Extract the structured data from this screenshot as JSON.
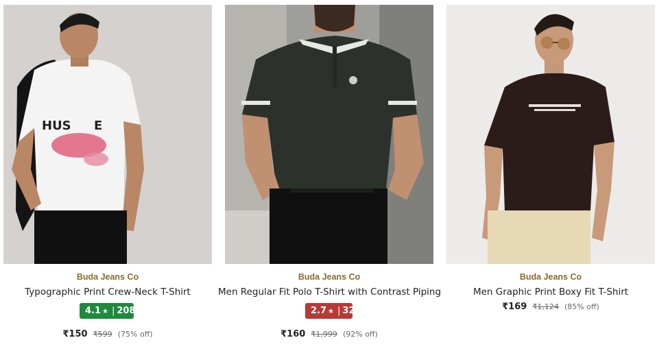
{
  "colors": {
    "brand": "#8a6a2c",
    "rating_green": "#1e8a3c",
    "rating_red": "#b73a37"
  },
  "products": [
    {
      "image_alt": "man in white graphic t-shirt holding black jacket",
      "brand": "Buda Jeans Co",
      "title": "Typographic Print Crew-Neck T-Shirt",
      "rating": "4.1",
      "star": "★",
      "reviews": "208",
      "price": "₹150",
      "mrp": "₹599",
      "off": "(75% off)"
    },
    {
      "image_alt": "man in dark green polo t-shirt with contrast piping",
      "brand": "Buda Jeans Co",
      "title": "Men Regular Fit Polo T-Shirt with Contrast Piping",
      "rating": "2.7",
      "star": "★",
      "reviews": "32",
      "price": "₹160",
      "mrp": "₹1,999",
      "off": "(92% off)"
    },
    {
      "image_alt": "man in brown boxy fit graphic t-shirt wearing sunglasses",
      "brand": "Buda Jeans Co",
      "title": "Men Graphic Print Boxy Fit T-Shirt",
      "price": "₹169",
      "mrp": "₹1,124",
      "off": "(85% off)"
    }
  ]
}
